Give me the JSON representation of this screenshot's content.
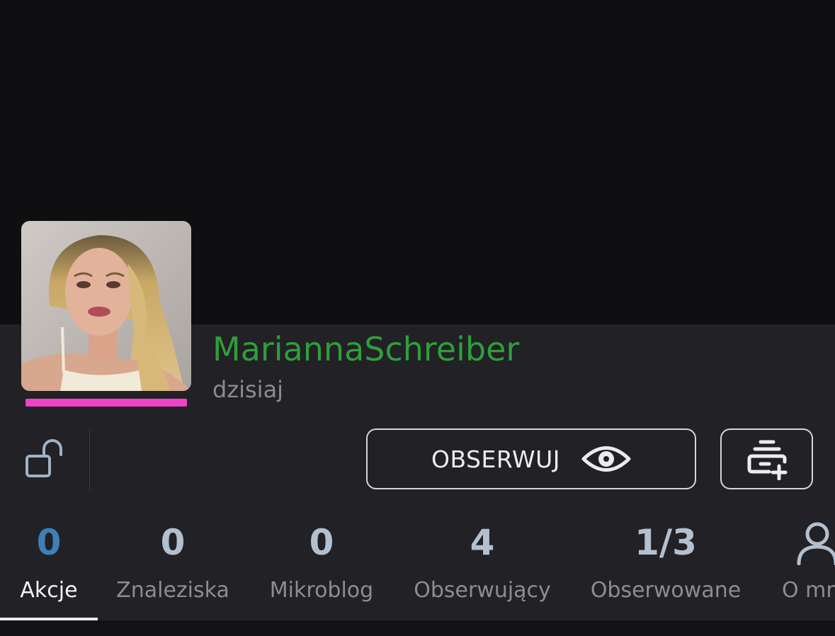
{
  "profile": {
    "username": "MariannaSchreiber",
    "member_since": "dzisiaj",
    "username_color": "#2f9e3a",
    "sex_color": "#f042c8"
  },
  "actions": {
    "follow_label": "OBSERWUJ",
    "lock_icon": "lock-open-icon",
    "follow_icon": "eye-icon",
    "blacklist_icon": "blacklist-add-icon"
  },
  "tabs": [
    {
      "count": "0",
      "label": "Akcje",
      "active": true
    },
    {
      "count": "0",
      "label": "Znaleziska"
    },
    {
      "count": "0",
      "label": "Mikroblog"
    },
    {
      "count": "4",
      "label": "Obserwujący"
    },
    {
      "count": "1/3",
      "label": "Obserwowane"
    },
    {
      "label": "O mn",
      "icon": "person-icon"
    }
  ],
  "colors": {
    "active_count": "#3f7fb5",
    "count": "#b2c0cf",
    "panel": "#212126",
    "background": "#0f0f11"
  }
}
